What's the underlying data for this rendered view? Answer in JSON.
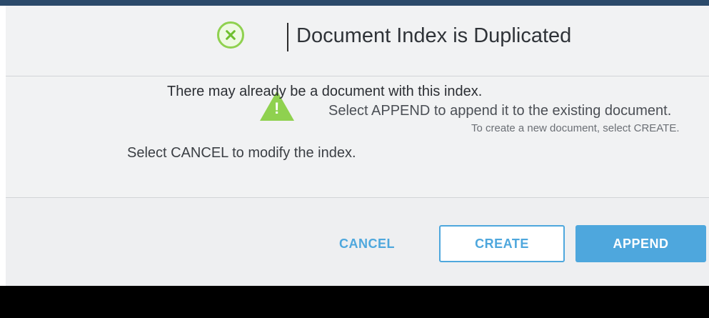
{
  "dialog": {
    "title": "Document Index is Duplicated",
    "messages": [
      "There may already be a document with this index.",
      "Select APPEND to append it to the existing document.",
      "To create a new document, select CREATE.",
      "Select CANCEL to modify the index."
    ],
    "buttons": {
      "cancel": "CANCEL",
      "create": "CREATE",
      "append": "APPEND"
    }
  },
  "colors": {
    "accent": "#4ea7dd",
    "icon_green": "#8fd14f",
    "dialog_bg": "#f1f2f3"
  },
  "icons": {
    "title_icon": "error-x-icon",
    "warning_icon": "warning-icon"
  }
}
